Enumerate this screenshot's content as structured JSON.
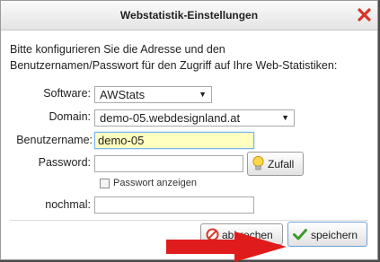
{
  "dialog": {
    "title": "Webstatistik-Einstellungen",
    "intro_line1": "Bitte konfigurieren Sie die Adresse und den",
    "intro_line2": "Benutzernamen/Passwort für den Zugriff auf Ihre Web-Statistiken:"
  },
  "form": {
    "software": {
      "label": "Software:",
      "value": "AWStats"
    },
    "domain": {
      "label": "Domain:",
      "value": "demo-05.webdesignland.at"
    },
    "username": {
      "label": "Benutzername:",
      "value": "demo-05"
    },
    "password": {
      "label": "Password:",
      "value": "",
      "random_button": "Zufall"
    },
    "show_password": {
      "label": "Passwort anzeigen",
      "checked": false
    },
    "repeat": {
      "label": "nochmal:",
      "value": ""
    }
  },
  "buttons": {
    "cancel": "abbrechen",
    "save": "speichern"
  },
  "colors": {
    "highlight_field": "#ffffc0",
    "arrow": "#e01b1b",
    "close_icon": "#d9342b"
  }
}
